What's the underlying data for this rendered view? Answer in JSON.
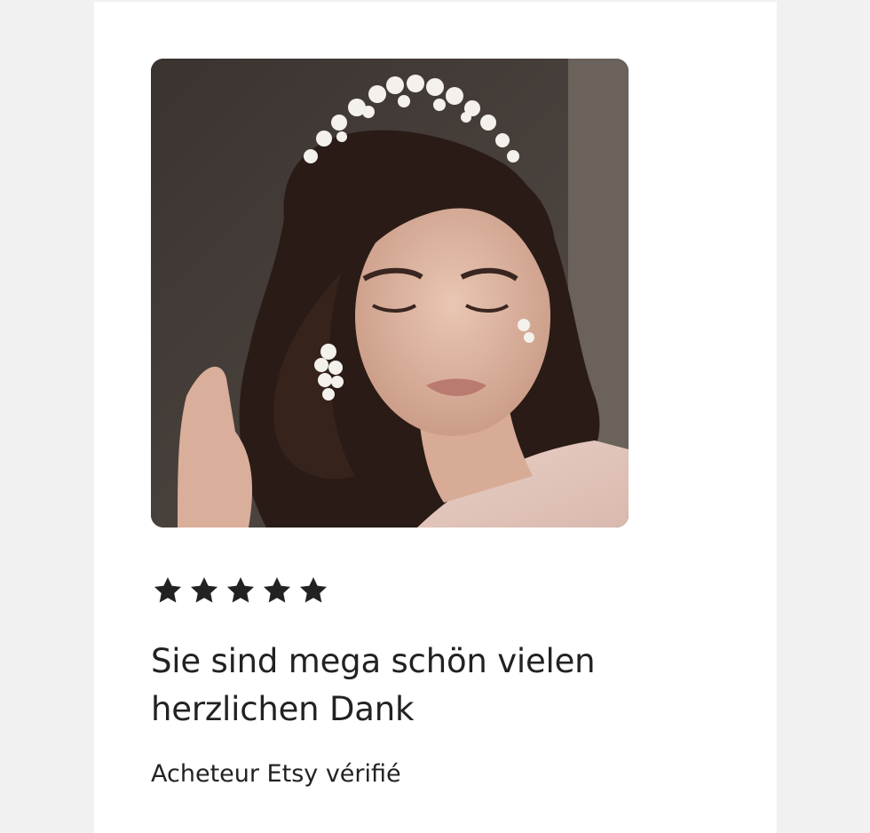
{
  "review": {
    "rating": 5,
    "rating_max": 5,
    "photo_icon": "review-photo-woman-floral-tiara",
    "star_color": "#222222",
    "text": "Sie sind mega schön vielen herzlichen Dank",
    "reviewer": "Acheteur Etsy vérifié"
  }
}
